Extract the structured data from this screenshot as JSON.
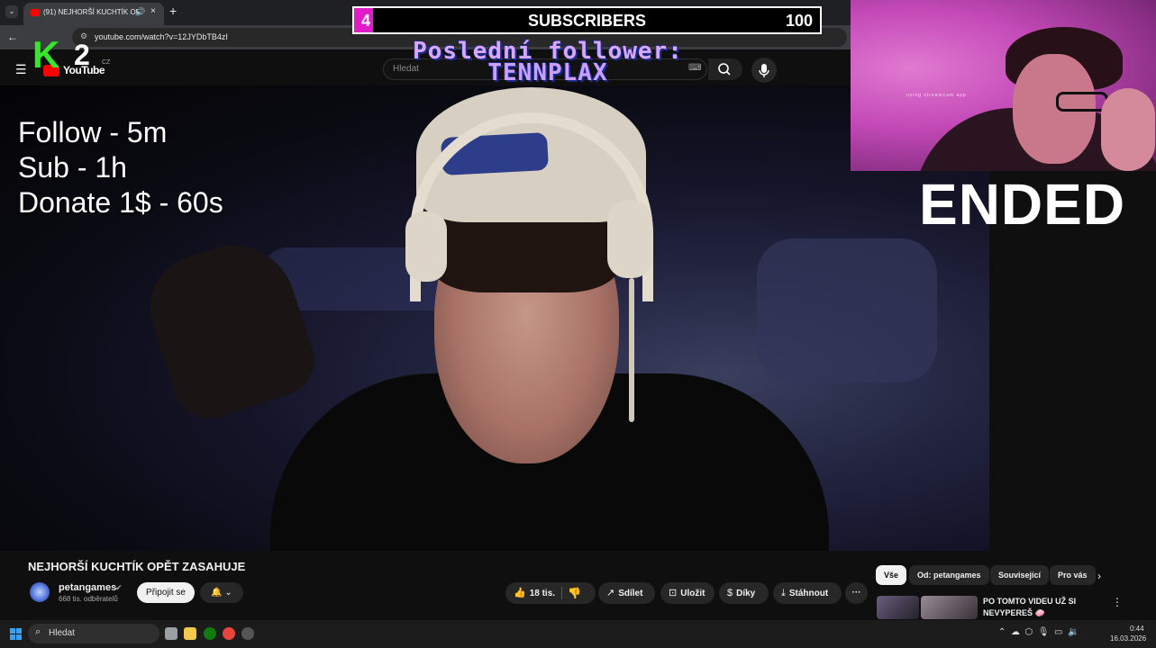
{
  "browser": {
    "tab_title": "(91) NEJHORŠÍ KUCHTÍK OP",
    "url": "youtube.com/watch?v=12JYDbTB4zI",
    "newtab_glyph": "+",
    "close_glyph": "×",
    "back_glyph": "←"
  },
  "youtube": {
    "logo_text": "YouTube",
    "region": "CZ",
    "search_placeholder": "Hledat"
  },
  "overlays": {
    "subscribers": {
      "current": "4",
      "label": "SUBSCRIBERS",
      "goal": "100",
      "progress_fraction": 0.04,
      "fill_color": "#e01cc8"
    },
    "follower_label": "Poslední follower:",
    "follower_name": "TENNPLAX",
    "k2_logo": {
      "k": "K",
      "two": "2"
    },
    "timers": [
      "Follow - 5m",
      "Sub - 1h",
      "Donate 1$ - 60s"
    ],
    "ended_text": "ENDED",
    "webcam_watermark": "using streamcam app"
  },
  "video": {
    "title": "NEJHORŠÍ KUCHTÍK OPĚT ZASAHUJE",
    "channel_name": "petangames",
    "channel_subs": "668 tis. odběratelů",
    "join_label": "Připojit se",
    "bell_icon": "bell-icon",
    "like_count": "18 tis.",
    "share_label": "Sdílet",
    "save_label": "Uložit",
    "thanks_label": "Díky",
    "download_label": "Stáhnout",
    "more_glyph": "···"
  },
  "sidebar": {
    "chips": [
      "Vše",
      "Od: petangames",
      "Související",
      "Pro vás"
    ],
    "recommendation": {
      "title_line1": "PO TOMTO VIDEU UŽ SI",
      "title_line2": "NEVYPEREŠ 🧼"
    }
  },
  "taskbar": {
    "search_placeholder": "Hledat",
    "time": "0:44",
    "date": "16.03.2026"
  },
  "colors": {
    "accent_red": "#ff0000",
    "k2_green": "#35e62a",
    "overlay_pink": "#e01cc8",
    "follower_purple": "#c9a0ff"
  }
}
